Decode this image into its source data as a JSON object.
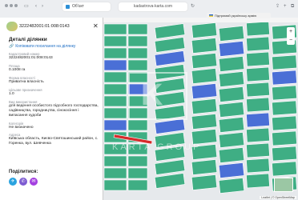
{
  "browser": {
    "tab_title": "Обʼєкт",
    "url": "kadastrova-karta.com",
    "flag_text": "Підтримай українську армію",
    "back_icon": "chevron-left-icon",
    "forward_icon": "chevron-right-icon",
    "share_icon": "share-icon",
    "newtab_icon": "plus-icon",
    "tabs_icon": "tabs-icon"
  },
  "search": {
    "cadastral_number": "3222482001:01:008:0143"
  },
  "panel": {
    "title": "Деталі ділянки",
    "copy_label": "Копіювати посилання на ділянку",
    "fields": [
      {
        "label": "Кадастровий номер",
        "value": "3222482001:01:008:0143"
      },
      {
        "label": "Площа",
        "value": "0.1008 га"
      },
      {
        "label": "Форма власності",
        "value": "Приватна власність"
      },
      {
        "label": "Цільове призначення",
        "value": "1.0"
      },
      {
        "label": "Вид використання",
        "value": "для ведення особистого підсобного господарства, садівництва, городництва, сінокосіння і випасання худоби"
      },
      {
        "label": "Категорія",
        "value": "Не визначено"
      },
      {
        "label": "Адреса",
        "value": "Київська область, Києво-Святошинський район, с. Горенка, вул. Шевченка"
      }
    ],
    "share_title": "Поділитися:",
    "share_buttons": [
      {
        "name": "telegram",
        "color": "#2aa3df",
        "glyph": "✈"
      },
      {
        "name": "viber",
        "color": "#7d5bd1",
        "glyph": "✆"
      },
      {
        "name": "messenger",
        "color": "#a33fe0",
        "glyph": "✉"
      }
    ]
  },
  "map": {
    "watermark": "KARTA GROUP",
    "zoom_in": "+",
    "zoom_out": "−",
    "attribution": "Leaflet | © OpenStreetMap",
    "colors": {
      "parcel_green": "#3fae84",
      "parcel_blue": "#4a6fd6",
      "selected_red": "#d62b2b"
    }
  }
}
